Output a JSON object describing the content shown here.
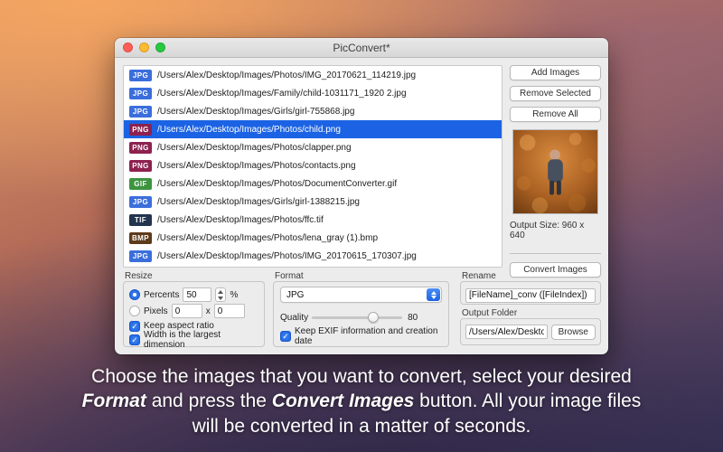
{
  "window": {
    "title": "PicConvert*"
  },
  "colors": {
    "badges": {
      "JPG": "#3b6edc",
      "PNG": "#8e2150",
      "GIF": "#3d9440",
      "TIF": "#22344e",
      "BMP": "#5d3a1a"
    },
    "selection": "#1b63e4",
    "accent": "#1b63e4"
  },
  "file_list": {
    "selected_index": 3,
    "items": [
      {
        "type": "JPG",
        "path": "/Users/Alex/Desktop/Images/Photos/IMG_20170621_114219.jpg"
      },
      {
        "type": "JPG",
        "path": "/Users/Alex/Desktop/Images/Family/child-1031171_1920 2.jpg"
      },
      {
        "type": "JPG",
        "path": "/Users/Alex/Desktop/Images/Girls/girl-755868.jpg"
      },
      {
        "type": "PNG",
        "path": "/Users/Alex/Desktop/Images/Photos/child.png"
      },
      {
        "type": "PNG",
        "path": "/Users/Alex/Desktop/Images/Photos/clapper.png"
      },
      {
        "type": "PNG",
        "path": "/Users/Alex/Desktop/Images/Photos/contacts.png"
      },
      {
        "type": "GIF",
        "path": "/Users/Alex/Desktop/Images/Photos/DocumentConverter.gif"
      },
      {
        "type": "JPG",
        "path": "/Users/Alex/Desktop/Images/Girls/girl-1388215.jpg"
      },
      {
        "type": "TIF",
        "path": "/Users/Alex/Desktop/Images/Photos/ffc.tif"
      },
      {
        "type": "BMP",
        "path": "/Users/Alex/Desktop/Images/Photos/lena_gray (1).bmp"
      },
      {
        "type": "JPG",
        "path": "/Users/Alex/Desktop/Images/Photos/IMG_20170615_170307.jpg"
      }
    ]
  },
  "sidebar": {
    "add_label": "Add Images",
    "remove_selected_label": "Remove Selected",
    "remove_all_label": "Remove All",
    "output_size": "Output Size: 960 x 640",
    "convert_label": "Convert Images"
  },
  "resize": {
    "group_label": "Resize",
    "percents_label": "Percents",
    "percents_value": "50",
    "percent_symbol": "%",
    "pixels_label": "Pixels",
    "pixels_width": "0",
    "pixels_separator": "x",
    "pixels_height": "0",
    "keep_aspect_label": "Keep aspect ratio",
    "width_largest_label": "Width is the largest dimension"
  },
  "format": {
    "group_label": "Format",
    "selected": "JPG",
    "quality_label": "Quality",
    "quality_value": "80",
    "exif_label": "Keep EXIF information and creation date"
  },
  "rename": {
    "group_label": "Rename",
    "pattern": "[FileName]_conv ([FileIndex])"
  },
  "output_folder": {
    "group_label": "Output Folder",
    "path": "/Users/Alex/Desktop",
    "browse_label": "Browse"
  },
  "caption": {
    "line1": "Choose the images that you want to convert, select your desired",
    "line2_format": "Format",
    "line2_mid": " and press the ",
    "line2_convert": "Convert Images",
    "line2_end": " button. All your image files",
    "line3": "will be converted in a matter of seconds."
  }
}
